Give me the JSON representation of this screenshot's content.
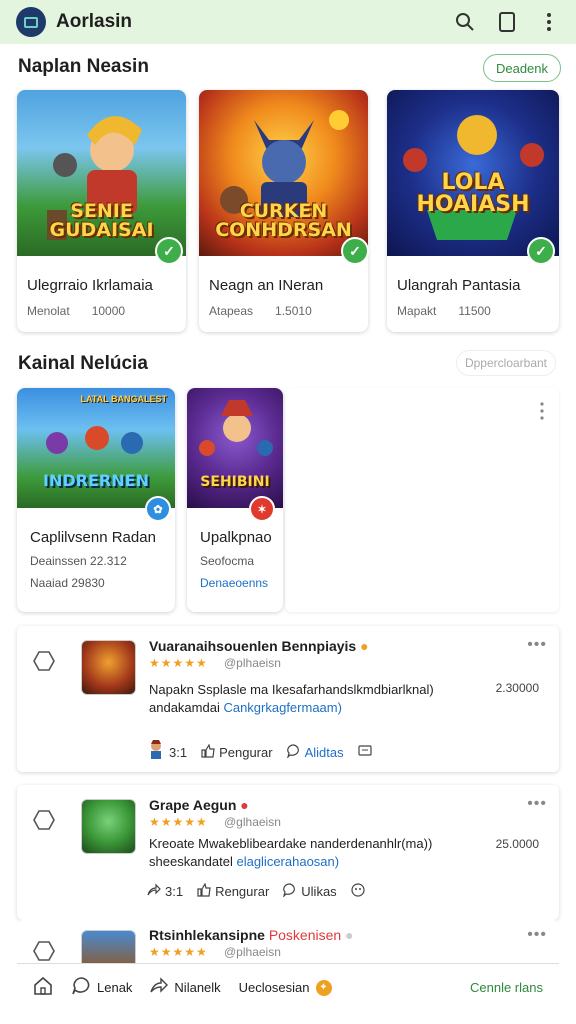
{
  "app": {
    "title": "Aorlasin"
  },
  "section1": {
    "title": "Naplan Neasin",
    "action_label": "Deadenk"
  },
  "featured": [
    {
      "thumb_title": "SENIE GUDAISAI",
      "name": "Ulegrraio Ikrlamaia",
      "meta_a": "Menolat",
      "meta_b": "10000",
      "badge_color": "#3eae4a"
    },
    {
      "thumb_title": "CURKEN CONHDRSAN",
      "name": "Neagn an INeran",
      "meta_a": "Atapeas",
      "meta_b": "1.5010",
      "badge_color": "#3eae4a"
    },
    {
      "thumb_title": "LOLA HOAIASH",
      "name": "Ulangrah Pantasia",
      "meta_a": "Mapakt",
      "meta_b": "11500",
      "badge_color": "#3eae4a"
    }
  ],
  "section2": {
    "title": "Kainal Nelúcia",
    "action_label": "Dppercloarbant"
  },
  "small_cards": [
    {
      "thumb_title": "INDRERNEN",
      "top_text": "LATAL BANGALEST",
      "name": "Caplilvsenn Radan",
      "line1": "Deainssen 22.312",
      "line2": "Naaiad  29830",
      "badge_color": "#2e8fe0",
      "badge_glyph": "✿"
    },
    {
      "thumb_title": "SEHIBINI",
      "name": "Upalkpnao",
      "line1": "Seofocma",
      "line2": "Denaeoenns",
      "badge_color": "#e03a2e",
      "badge_glyph": "✶"
    }
  ],
  "posts": [
    {
      "name": "Vuaranaihsouenlen Bennpiayis",
      "stars": "★★★★★",
      "handle": "@plhaeisn",
      "text": "Napakn Ssplasle ma Ikesafarhandslkmdbiarlknal)",
      "text2": "andakamdai",
      "tag": "Cankgrkagfermaam)",
      "count": "2.30000",
      "act1": "3:1",
      "act2": "Pengurar",
      "act3": "Alidtas"
    },
    {
      "name": "Grape Aegun",
      "stars": "★★★★★",
      "handle": "@glhaeisn",
      "text": "Kreoate Mwakeblibeardake nanderdenanhlr(ma))",
      "text2": "sheeskandatel",
      "tag": "elaglicerahaosan)",
      "count": "25.0000",
      "act1": "3:1",
      "act2": "Rengurar",
      "act3": "Ulikas"
    },
    {
      "name": "Rtsinhlekansipne",
      "name_tag": "Poskenisen",
      "stars": "★★★★★",
      "handle": "@plhaeisn"
    }
  ],
  "bottom_nav": {
    "item1": "Lenak",
    "item2": "Nilanelk",
    "item3": "Ueclosesian",
    "right": "Cennle rlans"
  },
  "colors": {
    "accent": "#2e8b3c",
    "appbar": "#e4f5df",
    "link": "#1f6fc7",
    "star": "#f0a020"
  }
}
